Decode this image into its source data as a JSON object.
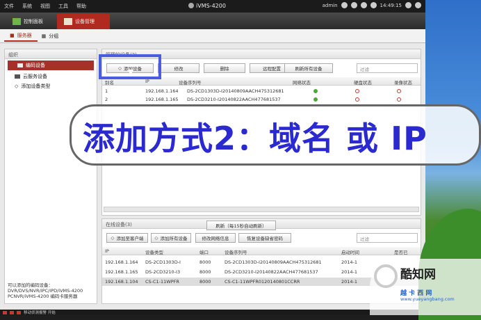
{
  "menu": {
    "items": [
      "文件",
      "系统",
      "视图",
      "工具",
      "帮助"
    ],
    "title": "iVMS-4200",
    "user": "admin",
    "time": "14:49:15"
  },
  "tabs": [
    {
      "label": "控制面板",
      "icon": "grid-icon"
    },
    {
      "label": "设备管理",
      "icon": "device-icon"
    }
  ],
  "subtabs": [
    "服务器",
    "分组"
  ],
  "left": {
    "header": "组织",
    "items": [
      "编码设备",
      "云服务设备",
      "添加设备类型"
    ],
    "note": [
      "可以添加的编码设备：",
      "DVR/DVS/NVR/IPC/IPD/iVMS-4200",
      "PCNVR/iVMS-4200 编码卡服务器"
    ]
  },
  "managed": {
    "header": "管理的设备(2)",
    "buttons": [
      "添加设备",
      "修改",
      "删除",
      "远程配置",
      "刷新所有设备"
    ],
    "filter": "过滤",
    "columns": [
      "别名",
      "IP",
      "设备序列号",
      "网络状态",
      "硬盘状态",
      "录像状态"
    ],
    "rows": [
      {
        "alias": "1",
        "ip": "192.168.1.164",
        "serial": "DS-2CD1303D-I20140809AACH475312681"
      },
      {
        "alias": "2",
        "ip": "192.168.1.165",
        "serial": "DS-2CD3210-I20140822AACH477681537"
      }
    ]
  },
  "online": {
    "header": "在线设备(3)",
    "refresh": "刷新（每15秒自动刷新）",
    "buttons": [
      "添加至客户端",
      "添加所有设备",
      "修改网络信息",
      "恢复设备缺省密码"
    ],
    "filter": "过滤",
    "columns": [
      "IP",
      "设备类型",
      "端口",
      "设备序列号",
      "启动时间",
      "是否已"
    ],
    "rows": [
      {
        "ip": "192.168.1.164",
        "type": "DS-2CD1303D-I",
        "port": "8000",
        "serial": "DS-2CD1303D-I20140809AACH475312681",
        "time": "2014-1"
      },
      {
        "ip": "192.168.1.165",
        "type": "DS-2CD3210-I3",
        "port": "8000",
        "serial": "DS-2CD3210-I20140822AACH477681537",
        "time": "2014-1"
      },
      {
        "ip": "192.168.1.104",
        "type": "CS-C1-11WPFR",
        "port": "8000",
        "serial": "CS-C1-11WPFR0120140801CCRR",
        "time": "2014-1"
      }
    ]
  },
  "overlay": "添加方式2：域名 或 IP",
  "statusbar": "移动侦测报警 开始",
  "watermark": {
    "brand": "酷知网",
    "site": "越 卡 西 网",
    "url": "www.yueyangbang.com"
  }
}
